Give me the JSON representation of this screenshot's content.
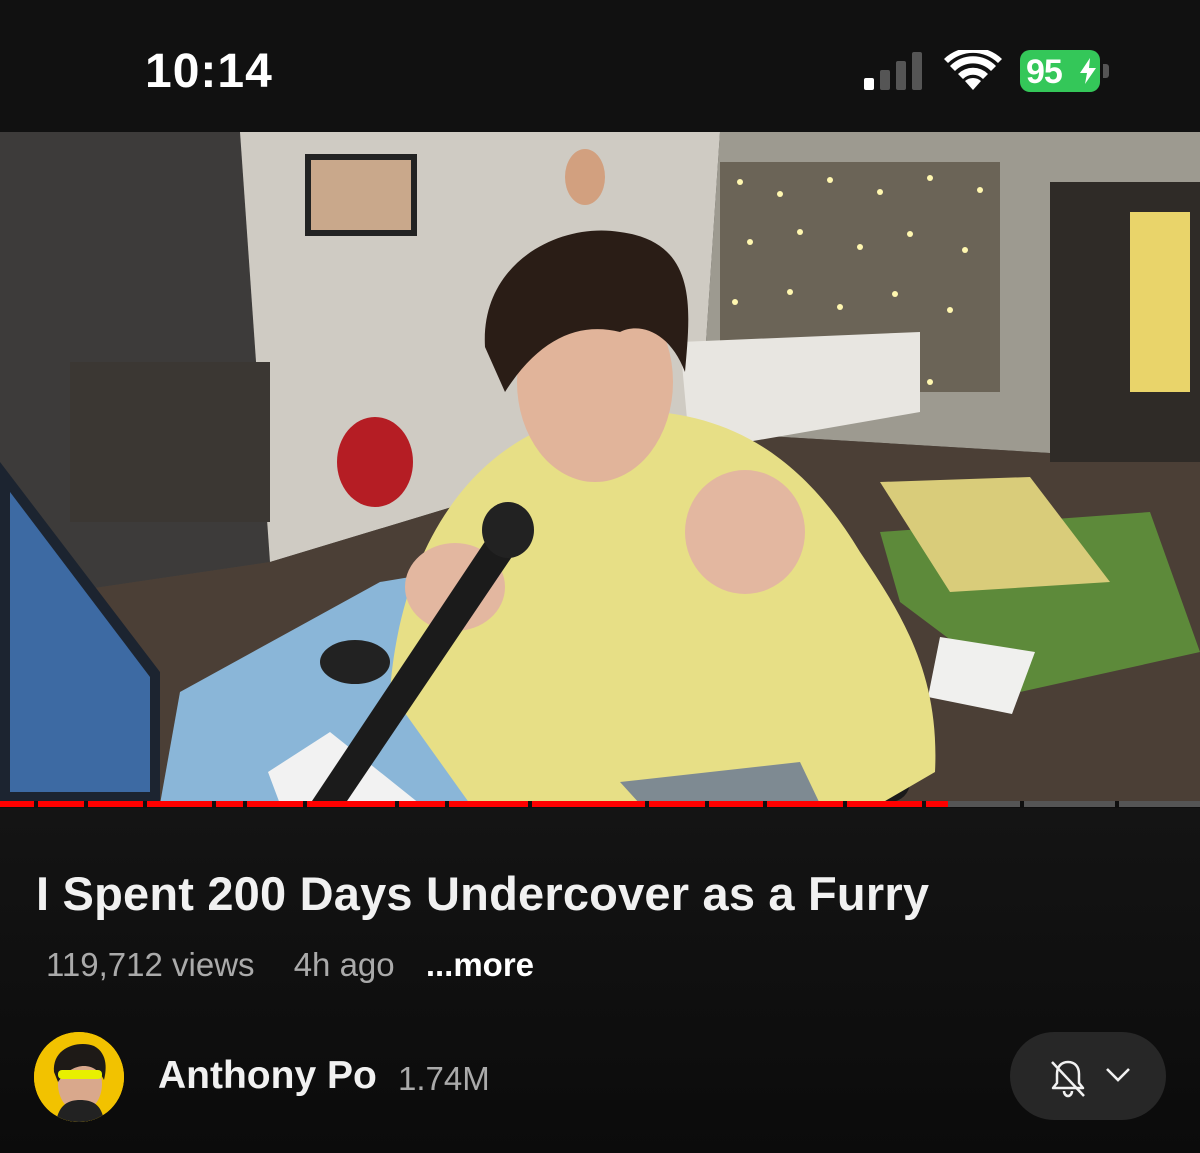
{
  "status_bar": {
    "time": "10:14",
    "battery": "95",
    "battery_color": "#34c759",
    "icons": [
      "cellular-signal-icon",
      "wifi-icon",
      "battery-charging-icon"
    ]
  },
  "player": {
    "progress_fraction": 0.79,
    "accent_color": "#ff0000"
  },
  "video": {
    "title": "I Spent 200 Days Undercover as a Furry",
    "views": "119,712 views",
    "age": "4h ago",
    "more_label": "...more"
  },
  "channel": {
    "name": "Anthony Po",
    "subscribers": "1.74M",
    "notification_icon": "bell-off-icon",
    "dropdown_icon": "chevron-down-icon"
  }
}
